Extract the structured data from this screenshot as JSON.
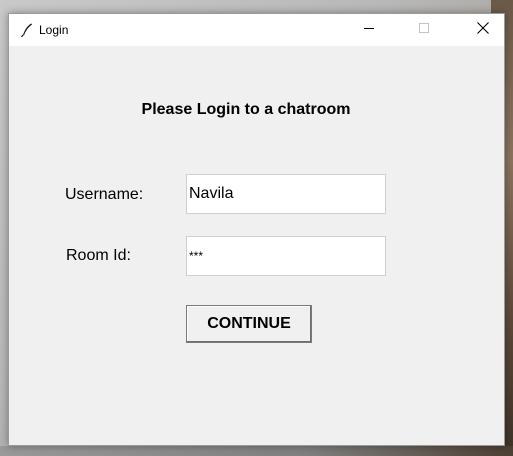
{
  "window": {
    "title": "Login"
  },
  "form": {
    "heading": "Please Login to a chatroom",
    "username_label": "Username:",
    "username_value": "Navila",
    "room_label": "Room Id:",
    "room_value": "***",
    "continue_label": "CONTINUE"
  },
  "icons": {
    "app": "feather-icon",
    "minimize": "minimize-icon",
    "maximize": "maximize-icon",
    "close": "close-icon"
  }
}
